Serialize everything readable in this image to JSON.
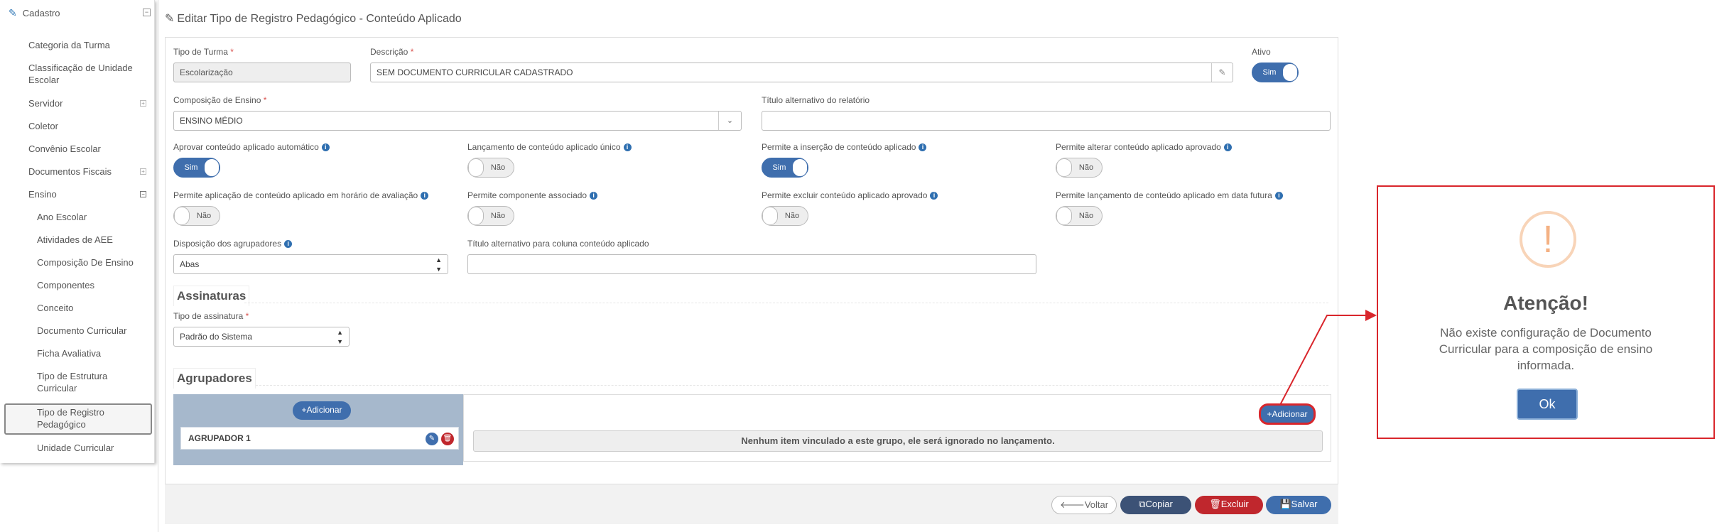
{
  "sidebar": {
    "header": "Cadastro",
    "items": [
      {
        "label": "Categoria da Turma"
      },
      {
        "label": "Classificação de Unidade Escolar"
      },
      {
        "label": "Servidor"
      },
      {
        "label": "Coletor"
      },
      {
        "label": "Convênio Escolar"
      },
      {
        "label": "Documentos Fiscais"
      },
      {
        "label": "Ensino"
      },
      {
        "label": "Ano Escolar"
      },
      {
        "label": "Atividades de AEE"
      },
      {
        "label": "Composição De Ensino"
      },
      {
        "label": "Componentes"
      },
      {
        "label": "Conceito"
      },
      {
        "label": "Documento Curricular"
      },
      {
        "label": "Ficha Avaliativa"
      },
      {
        "label": "Tipo de Estrutura Curricular"
      },
      {
        "label": "Tipo de Registro Pedagógico"
      },
      {
        "label": "Unidade Curricular"
      }
    ]
  },
  "page": {
    "title": "Editar Tipo de Registro Pedagógico - Conteúdo Aplicado"
  },
  "form": {
    "tipo_turma_label": "Tipo de Turma",
    "tipo_turma_value": "Escolarização",
    "descricao_label": "Descrição",
    "descricao_value": "SEM DOCUMENTO CURRICULAR CADASTRADO",
    "ativo_label": "Ativo",
    "ativo_value": "Sim",
    "composicao_label": "Composição de Ensino",
    "composicao_value": "ENSINO MÉDIO",
    "titulo_relatorio_label": "Título alternativo do relatório",
    "titulo_relatorio_value": "",
    "req_mark": "*",
    "info_glyph": "i",
    "toggles": [
      {
        "label": "Aprovar conteúdo aplicado automático",
        "value": "Sim"
      },
      {
        "label": "Lançamento de conteúdo aplicado único",
        "value": "Não"
      },
      {
        "label": "Permite a inserção de conteúdo aplicado",
        "value": "Sim"
      },
      {
        "label": "Permite alterar conteúdo aplicado aprovado",
        "value": "Não"
      },
      {
        "label": "Permite aplicação de conteúdo aplicado em horário de avaliação",
        "value": "Não"
      },
      {
        "label": "Permite componente associado",
        "value": "Não"
      },
      {
        "label": "Permite excluir conteúdo aplicado aprovado",
        "value": "Não"
      },
      {
        "label": "Permite lançamento de conteúdo aplicado em data futura",
        "value": "Não"
      }
    ],
    "disposicao_label": "Disposição dos agrupadores",
    "disposicao_value": "Abas",
    "titulo_coluna_label": "Título alternativo para coluna conteúdo aplicado",
    "titulo_coluna_value": ""
  },
  "assinaturas": {
    "heading": "Assinaturas",
    "tipo_label": "Tipo de assinatura",
    "tipo_value": "Padrão do Sistema"
  },
  "agrupadores": {
    "heading": "Agrupadores",
    "add_left": "Adicionar",
    "add_right": "Adicionar",
    "group_name": "AGRUPADOR 1",
    "empty_message": "Nenhum item vinculado a este grupo, ele será ignorado no lançamento."
  },
  "footer": {
    "voltar": "Voltar",
    "copiar": "Copiar",
    "excluir": "Excluir",
    "salvar": "Salvar"
  },
  "modal": {
    "icon": "!",
    "title": "Atenção!",
    "message": "Não existe configuração de Documento Curricular para a composição de ensino informada.",
    "ok": "Ok"
  },
  "colors": {
    "primary": "#3f6ead",
    "danger": "#c0272d",
    "dark": "#3c5276",
    "annotation": "#d9262c"
  }
}
